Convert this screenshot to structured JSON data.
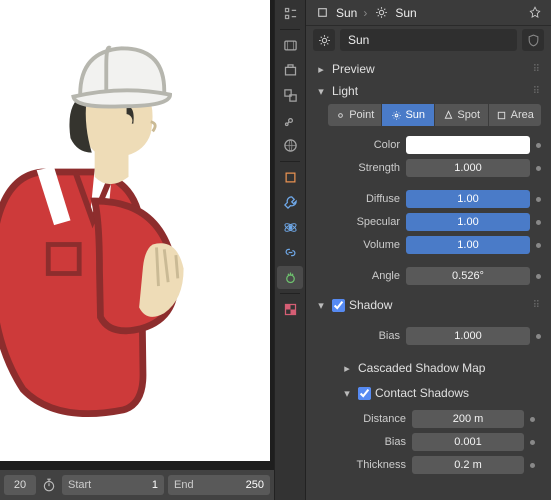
{
  "timeline": {
    "cur_frame": "20",
    "start_label": "Start",
    "start_val": "1",
    "end_label": "End",
    "end_val": "250"
  },
  "breadcrumb": {
    "obj": "Sun",
    "data": "Sun"
  },
  "name_field": "Sun",
  "sections": {
    "preview": "Preview",
    "light": "Light",
    "shadow": "Shadow",
    "csm": "Cascaded Shadow Map",
    "contact": "Contact Shadows"
  },
  "light_types": {
    "point": "Point",
    "sun": "Sun",
    "spot": "Spot",
    "area": "Area"
  },
  "light": {
    "color_label": "Color",
    "color_value": "#FFFFFF",
    "strength_label": "Strength",
    "strength_value": "1.000",
    "diffuse_label": "Diffuse",
    "diffuse_value": "1.00",
    "specular_label": "Specular",
    "specular_value": "1.00",
    "volume_label": "Volume",
    "volume_value": "1.00",
    "angle_label": "Angle",
    "angle_value": "0.526°"
  },
  "shadow": {
    "bias_label": "Bias",
    "bias_value": "1.000"
  },
  "contact": {
    "distance_label": "Distance",
    "distance_value": "200 m",
    "bias_label": "Bias",
    "bias_value": "0.001",
    "thickness_label": "Thickness",
    "thickness_value": "0.2 m"
  }
}
